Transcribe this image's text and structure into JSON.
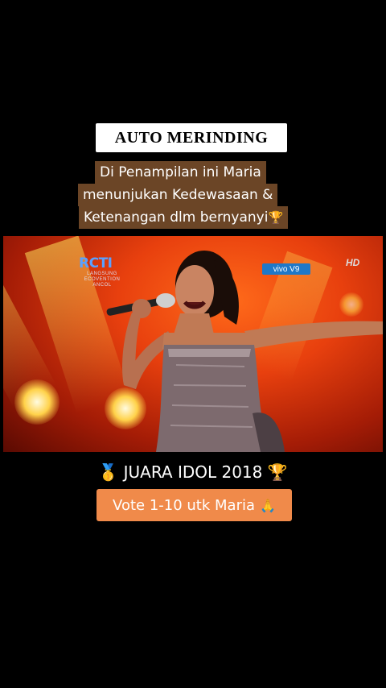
{
  "header": {
    "title": "AUTO MERINDING",
    "caption_lines": [
      "Di Penampilan ini Maria",
      "menunjukan Kedewasaan &",
      "Ketenangan dlm bernyanyi"
    ],
    "caption_icon": "trophy-icon"
  },
  "video": {
    "channel_logo": "RCTI",
    "channel_sub_1": "LANGSUNG",
    "channel_sub_2": "ECOVENTION",
    "channel_sub_3": "ANCOL",
    "sponsor_logo": "vivo V9",
    "quality_badge": "HD"
  },
  "footer": {
    "juara_text": "JUARA IDOL 2018",
    "juara_left_icon": "medal-icon",
    "juara_right_icon": "trophy-icon",
    "vote_text": "Vote 1-10 utk Maria",
    "vote_icon": "praying-hands-icon"
  },
  "colors": {
    "caption_bg": "#6b4526",
    "vote_bg": "#f08a4a",
    "stage_red": "#e8400e"
  }
}
